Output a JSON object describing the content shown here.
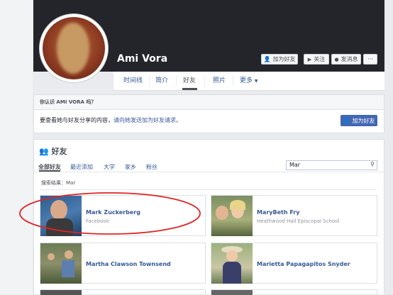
{
  "profile": {
    "name": "Ami Vora"
  },
  "header_actions": {
    "add_friend": "加为好友",
    "follow": "关注",
    "message": "发消息",
    "more": "···"
  },
  "nav": {
    "tabs": [
      "时间线",
      "简介",
      "好友",
      "照片",
      "更多"
    ]
  },
  "prompt": {
    "header": "你认识 AMI VORA 吗？",
    "text": "要查看她与好友分享的内容，",
    "link": "请向她发送加为好友请求。",
    "button": "加为好友"
  },
  "friends": {
    "title": "好友",
    "tabs": [
      "全部好友",
      "最近添加",
      "大学",
      "家乡",
      "粉丝"
    ],
    "search_value": "Mar",
    "results_label": "搜索结果：Mar",
    "items": [
      {
        "name": "Mark Zuckerberg",
        "subtitle": "Facebook"
      },
      {
        "name": "MaryBeth Fry",
        "subtitle": "Heathwood Hall Episcopal School"
      },
      {
        "name": "Martha Clawson Townsend",
        "subtitle": ""
      },
      {
        "name": "Marietta Papagapitos Snyder",
        "subtitle": ""
      }
    ]
  },
  "colors": {
    "brand": "#4267b2",
    "link": "#365899",
    "cover": "#24252a",
    "highlight": "#e02424"
  },
  "icons": [
    "add-friend-icon",
    "follow-icon",
    "message-icon",
    "friends-icon",
    "search-icon",
    "caret-down-icon"
  ]
}
